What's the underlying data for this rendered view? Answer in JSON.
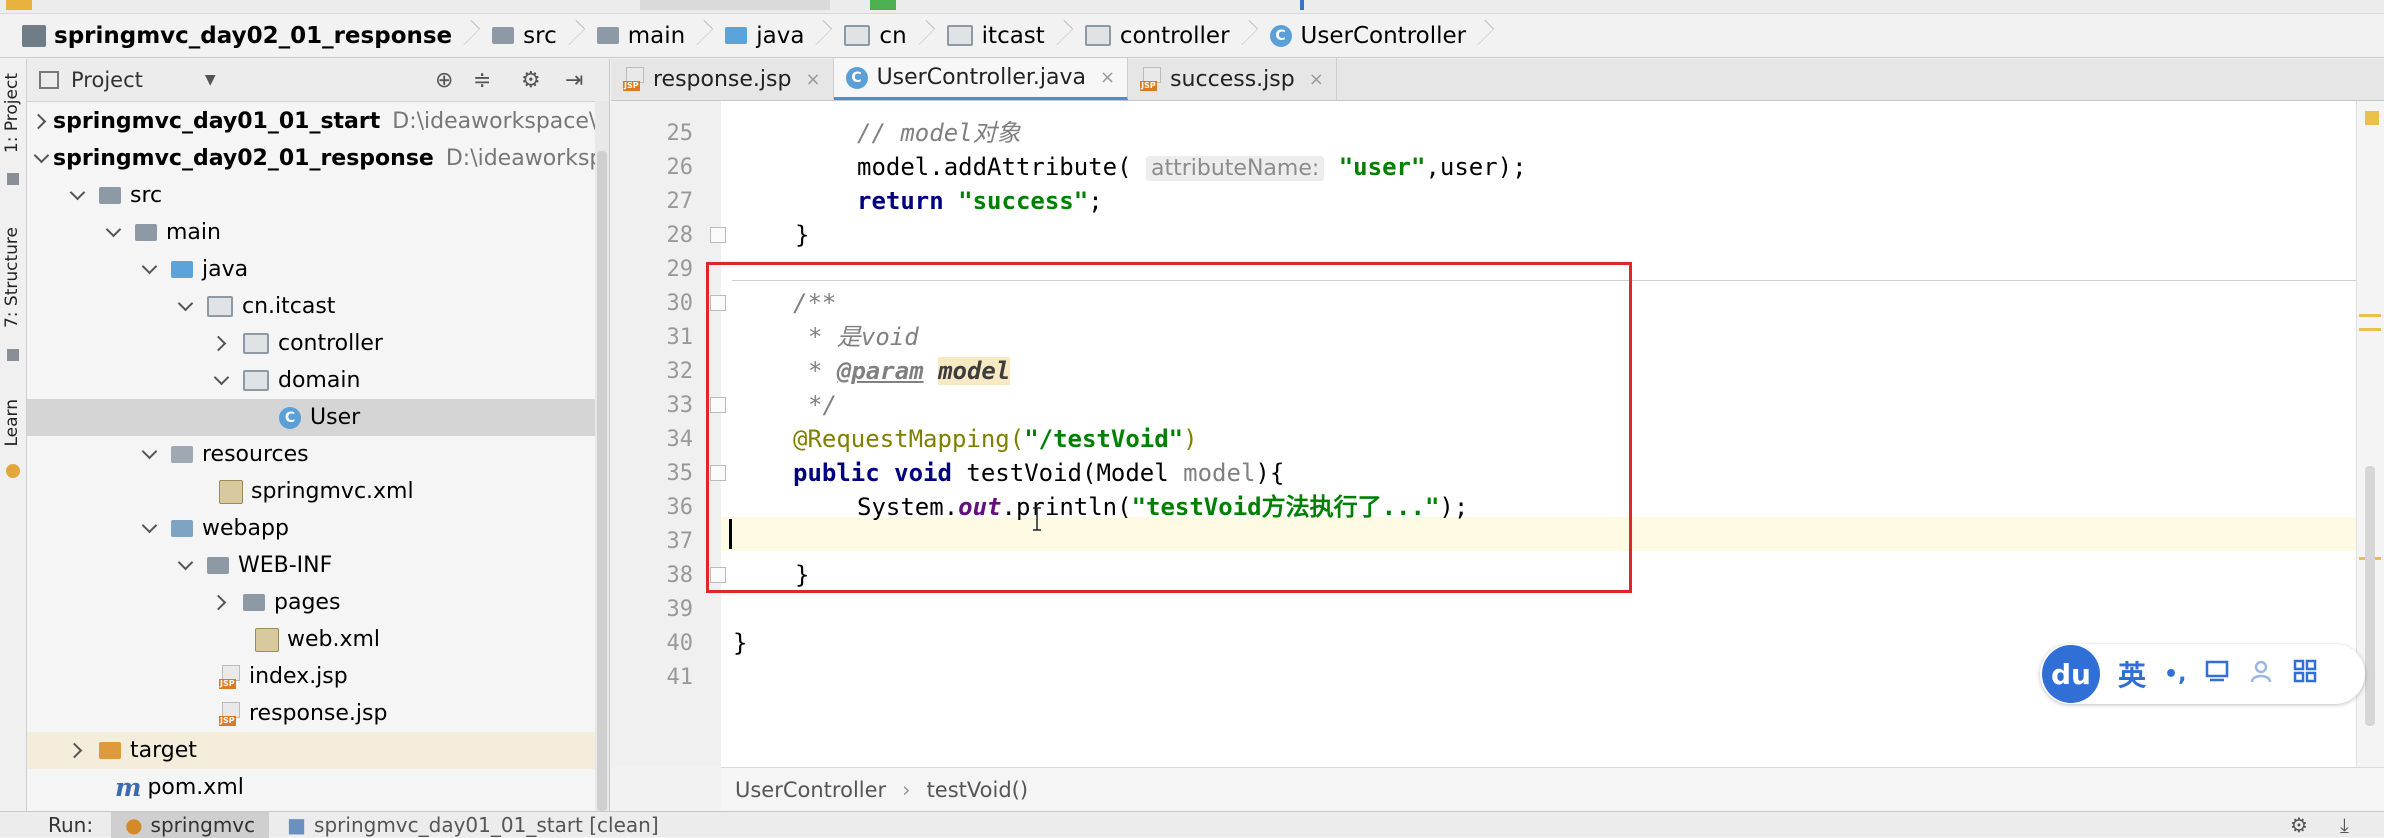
{
  "navbar": {
    "crumbs": [
      "springmvc_day02_01_response",
      "src",
      "main",
      "java",
      "cn",
      "itcast",
      "controller",
      "UserController"
    ]
  },
  "left_strip": {
    "project": "1: Project",
    "structure": "7: Structure",
    "learn": "Learn"
  },
  "project_panel": {
    "title": "Project",
    "tree": [
      {
        "label": "springmvc_day01_01_start",
        "path": "D:\\ideaworkspace\\Ide"
      },
      {
        "label": "springmvc_day02_01_response",
        "path": "D:\\ideaworkspa"
      },
      {
        "label": "src"
      },
      {
        "label": "main"
      },
      {
        "label": "java"
      },
      {
        "label": "cn.itcast"
      },
      {
        "label": "controller"
      },
      {
        "label": "domain"
      },
      {
        "label": "User"
      },
      {
        "label": "resources"
      },
      {
        "label": "springmvc.xml"
      },
      {
        "label": "webapp"
      },
      {
        "label": "WEB-INF"
      },
      {
        "label": "pages"
      },
      {
        "label": "web.xml"
      },
      {
        "label": "index.jsp"
      },
      {
        "label": "response.jsp"
      },
      {
        "label": "target"
      },
      {
        "label": "pom.xml"
      }
    ]
  },
  "tabs": [
    {
      "label": "response.jsp",
      "close": "×"
    },
    {
      "label": "UserController.java",
      "close": "×"
    },
    {
      "label": "success.jsp",
      "close": "×"
    }
  ],
  "editor": {
    "line_numbers": [
      "25",
      "26",
      "27",
      "28",
      "29",
      "30",
      "31",
      "32",
      "33",
      "34",
      "35",
      "36",
      "37",
      "38",
      "39",
      "40",
      "41"
    ],
    "l25_comment": "// model对象",
    "l26_a": "model.addAttribute(",
    "l26_hint": "attributeName:",
    "l26_str": "\"user\"",
    "l26_b": ",user);",
    "l27_kw": "return",
    "l27_str": "\"success\"",
    "l27_end": ";",
    "l28": "}",
    "l30": "/**",
    "l31": "* 是void",
    "l32_star": "* ",
    "l32_tag": "@param",
    "l32_name": "model",
    "l33": "*/",
    "l34_ann": "@RequestMapping(",
    "l34_str": "\"/testVoid\"",
    "l34_end": ")",
    "l35_kw": "public void",
    "l35_a": " testVoid(Model ",
    "l35_param": "model",
    "l35_b": "){",
    "l36_a": "System.",
    "l36_out": "out",
    "l36_b": ".println(",
    "l36_str": "\"testVoid方法执行了...\"",
    "l36_c": ");",
    "l38": "}",
    "l40": "}"
  },
  "footer": {
    "class_name": "UserController",
    "method_name": "testVoid()"
  },
  "run_bar": {
    "label": "Run:",
    "config": "springmvc",
    "other": "springmvc_day01_01_start [clean]"
  },
  "ime": {
    "logo": "du",
    "lang": "英",
    "punct": "•,"
  }
}
